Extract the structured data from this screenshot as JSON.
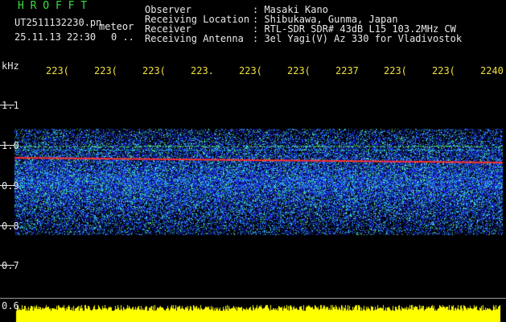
{
  "app": {
    "title": "H R O F F T",
    "filename": "UT2511132230.pn",
    "mode": "meteor",
    "datetime": "25.11.13 22:30",
    "counter": "0 .."
  },
  "info": {
    "rows": [
      {
        "label": "Observer",
        "value": ": Masaki Kano"
      },
      {
        "label": "Receiving Location",
        "value": ": Shibukawa, Gunma, Japan"
      },
      {
        "label": "Receiver",
        "value": ": RTL-SDR SDR# 43dB L15 103.2MHz CW"
      },
      {
        "label": "Receiving Antenna",
        "value": ": 3el Yagi(V) Az 330 for Vladivostok"
      }
    ]
  },
  "axis": {
    "unit": "kHz",
    "x_ticks": [
      "223(",
      "223(",
      "223(",
      "223.",
      "223(",
      "223(",
      "2237",
      "223(",
      "223(",
      "2240"
    ],
    "y_labels": [
      "1.1",
      "1.0",
      "0.9",
      "0.8",
      "0.7",
      "0.6"
    ]
  },
  "colors": {
    "background": "#000000",
    "noise_low": "#1a2ad8",
    "noise_mid": "#28b8e8",
    "noise_high": "#60f070",
    "carrier": "#ff3030",
    "amplitude_bar": "#ffff00",
    "header_green": "#3ce03c",
    "tick_yellow": "#f0e040"
  }
}
